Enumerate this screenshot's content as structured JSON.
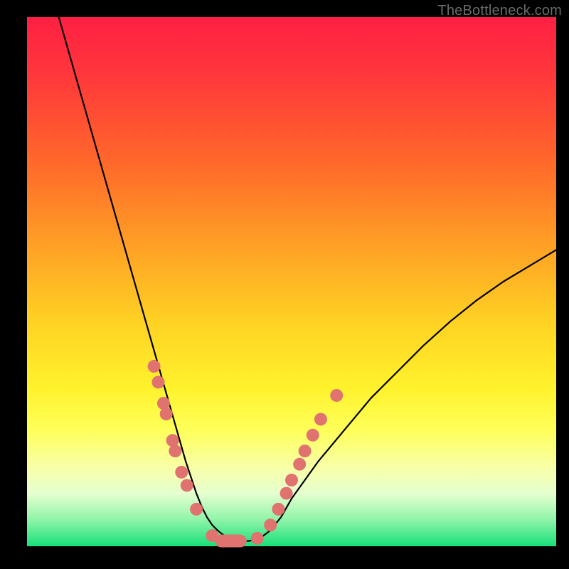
{
  "watermark": {
    "text": "TheBottleneck.com"
  },
  "colors": {
    "curve_stroke": "#000000",
    "marker_fill": "#e0736f",
    "marker_stroke": "#e0736f"
  },
  "chart_data": {
    "type": "line",
    "title": "",
    "xlabel": "",
    "ylabel": "",
    "xlim": [
      0,
      100
    ],
    "ylim": [
      0,
      100
    ],
    "grid": false,
    "legend": false,
    "series": [
      {
        "name": "curve",
        "x": [
          6,
          8,
          10,
          12,
          14,
          16,
          18,
          20,
          22,
          24,
          25,
          26,
          27,
          28,
          29,
          30,
          31,
          32,
          33,
          34,
          35,
          36,
          37,
          38,
          39,
          40,
          42,
          44,
          46,
          48,
          50,
          55,
          60,
          65,
          70,
          75,
          80,
          85,
          90,
          95,
          100
        ],
        "y": [
          100,
          93,
          86,
          79,
          72,
          65,
          58,
          51,
          44,
          37,
          33.5,
          30,
          26.5,
          23,
          19.5,
          16,
          13,
          10,
          7.5,
          5.5,
          4,
          3,
          2.2,
          1.6,
          1.2,
          1,
          1,
          1.5,
          3,
          5.5,
          9,
          16,
          22,
          28,
          33,
          38,
          42.5,
          46.5,
          50,
          53,
          56
        ]
      }
    ],
    "markers": [
      {
        "x": 24.0,
        "y": 34.0,
        "kind": "dot"
      },
      {
        "x": 24.8,
        "y": 31.0,
        "kind": "dot"
      },
      {
        "x": 25.8,
        "y": 27.0,
        "kind": "dot"
      },
      {
        "x": 26.3,
        "y": 25.0,
        "kind": "dot"
      },
      {
        "x": 27.5,
        "y": 20.0,
        "kind": "dot"
      },
      {
        "x": 28.0,
        "y": 18.0,
        "kind": "dot"
      },
      {
        "x": 29.2,
        "y": 14.0,
        "kind": "dot"
      },
      {
        "x": 30.2,
        "y": 11.5,
        "kind": "dot"
      },
      {
        "x": 32.0,
        "y": 7.0,
        "kind": "dot"
      },
      {
        "x": 35.0,
        "y": 2.0,
        "kind": "dot"
      },
      {
        "x": 38.5,
        "y": 1.0,
        "kind": "pill",
        "w": 6
      },
      {
        "x": 43.5,
        "y": 1.5,
        "kind": "dot"
      },
      {
        "x": 46.0,
        "y": 4.0,
        "kind": "dot"
      },
      {
        "x": 47.5,
        "y": 7.0,
        "kind": "dot"
      },
      {
        "x": 49.0,
        "y": 10.0,
        "kind": "dot"
      },
      {
        "x": 50.0,
        "y": 12.5,
        "kind": "dot"
      },
      {
        "x": 51.5,
        "y": 15.5,
        "kind": "dot"
      },
      {
        "x": 52.5,
        "y": 18.0,
        "kind": "dot"
      },
      {
        "x": 54.0,
        "y": 21.0,
        "kind": "dot"
      },
      {
        "x": 55.5,
        "y": 24.0,
        "kind": "dot"
      },
      {
        "x": 58.5,
        "y": 28.5,
        "kind": "dot"
      }
    ]
  }
}
